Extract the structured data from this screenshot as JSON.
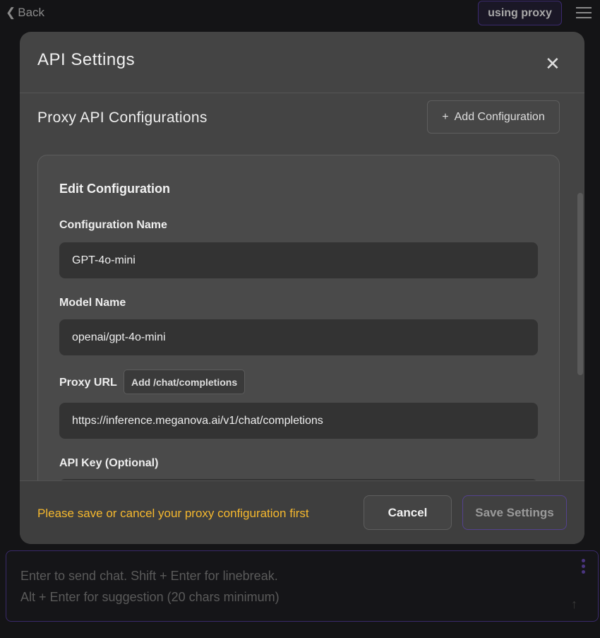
{
  "topbar": {
    "back_label": "Back",
    "proxy_badge": "using proxy"
  },
  "modal": {
    "title": "API Settings",
    "section_title": "Proxy API Configurations",
    "add_configuration_label": "Add Configuration",
    "edit": {
      "title": "Edit Configuration",
      "config_name_label": "Configuration Name",
      "config_name_value": "GPT-4o-mini",
      "model_name_label": "Model Name",
      "model_name_value": "openai/gpt-4o-mini",
      "proxy_url_label": "Proxy URL",
      "add_suffix_label": "Add /chat/completions",
      "proxy_url_value": "https://inference.meganova.ai/v1/chat/completions",
      "api_key_label": "API Key (Optional)"
    },
    "footer": {
      "warning": "Please save or cancel your proxy configuration first",
      "cancel_label": "Cancel",
      "save_label": "Save Settings"
    }
  },
  "chat": {
    "placeholder_line1": "Enter to send chat. Shift + Enter for linebreak.",
    "placeholder_line2": "Alt + Enter for suggestion (20 chars minimum)"
  }
}
